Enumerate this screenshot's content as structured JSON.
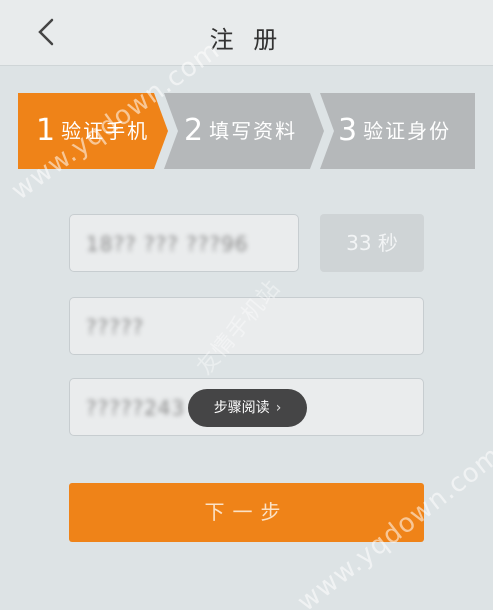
{
  "header": {
    "back_icon": "chevron-left-icon",
    "title": "注 册"
  },
  "steps": [
    {
      "number": "1",
      "label": "验证手机",
      "active": true
    },
    {
      "number": "2",
      "label": "填写资料",
      "active": false
    },
    {
      "number": "3",
      "label": "验证身份",
      "active": false
    }
  ],
  "colors": {
    "active_step": "#ef8318",
    "inactive_step": "#b5b8ba",
    "button": "#ef8318",
    "background": "#dde3e5"
  },
  "form": {
    "phone_value": "18?? ??? ???96",
    "countdown_label": "33 秒",
    "code_value": "?????",
    "password_value": "?????243",
    "next_label": "下一步"
  },
  "overlay": {
    "tooltip_label": "步骤阅读",
    "tooltip_chevron": "›"
  },
  "watermarks": {
    "wm1": "www.yqdown.com",
    "wm2": "www.yqdown.com",
    "wm3": "友情手机站"
  }
}
